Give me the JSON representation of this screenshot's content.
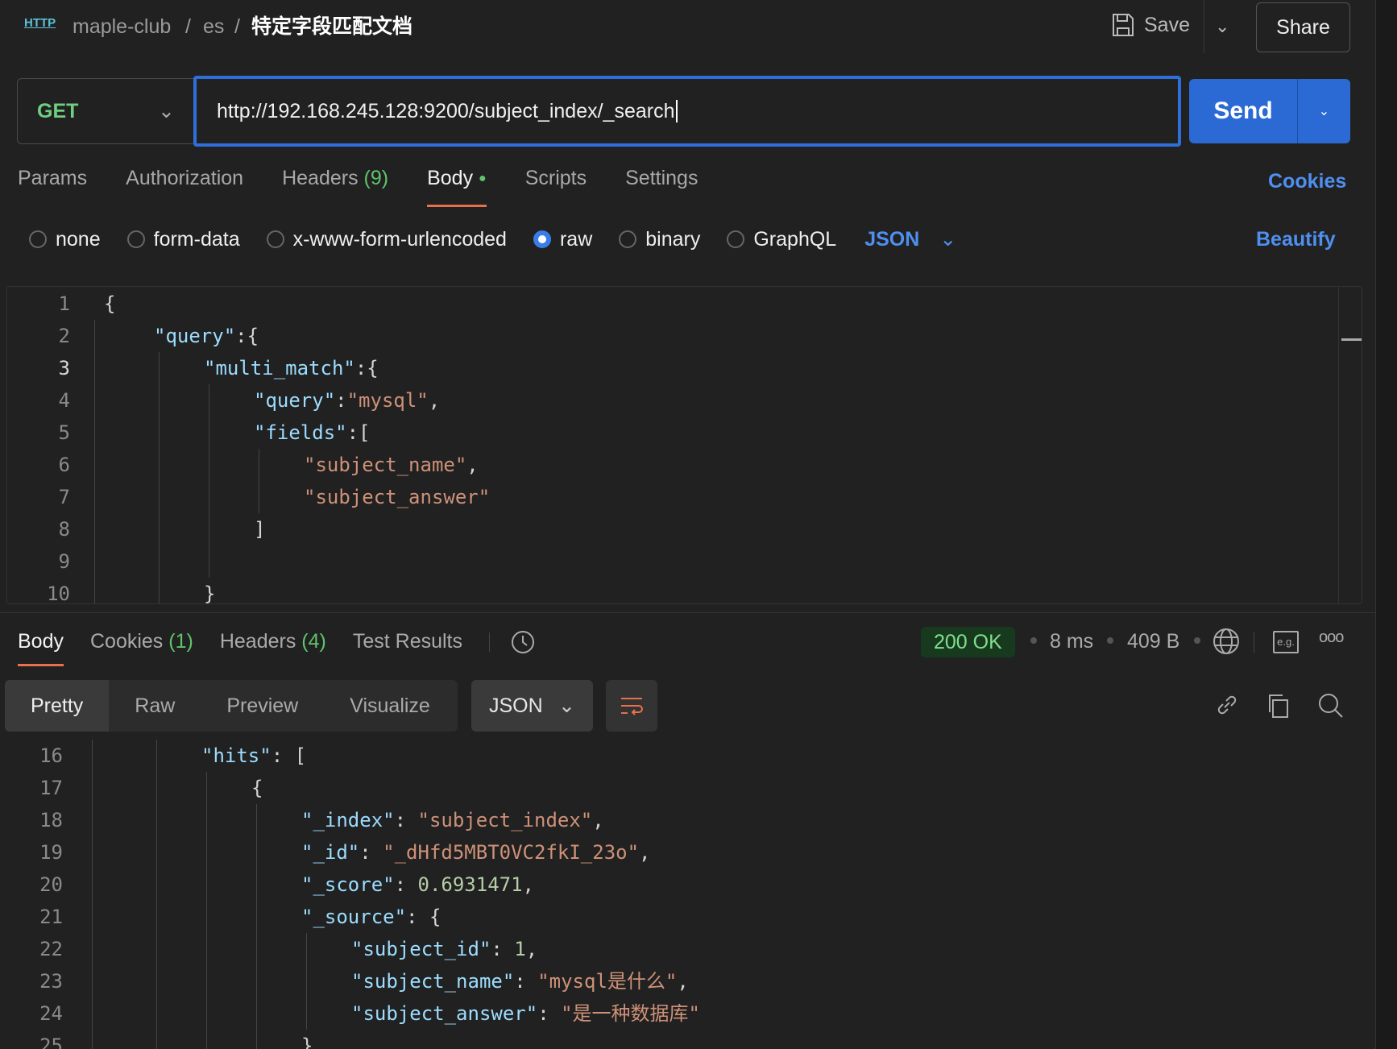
{
  "header": {
    "breadcrumb": [
      "maple-club",
      "es",
      "特定字段匹配文档"
    ],
    "save_label": "Save",
    "share_label": "Share"
  },
  "request": {
    "method": "GET",
    "url": "http://192.168.245.128:9200/subject_index/_search",
    "send_label": "Send"
  },
  "request_tabs": [
    {
      "label": "Params"
    },
    {
      "label": "Authorization"
    },
    {
      "label": "Headers",
      "count": "(9)"
    },
    {
      "label": "Body",
      "active": true,
      "dot": true
    },
    {
      "label": "Scripts"
    },
    {
      "label": "Settings"
    }
  ],
  "cookies_label": "Cookies",
  "body_types": [
    {
      "label": "none"
    },
    {
      "label": "form-data"
    },
    {
      "label": "x-www-form-urlencoded"
    },
    {
      "label": "raw",
      "selected": true
    },
    {
      "label": "binary"
    },
    {
      "label": "GraphQL"
    }
  ],
  "body_format": "JSON",
  "beautify_label": "Beautify",
  "request_body": [
    {
      "n": 1,
      "i": 0,
      "t": [
        [
          "p",
          "{"
        ]
      ]
    },
    {
      "n": 2,
      "i": 1,
      "t": [
        [
          "k",
          "\"query\""
        ],
        [
          "p",
          ":{"
        ]
      ]
    },
    {
      "n": 3,
      "i": 2,
      "t": [
        [
          "k",
          "\"multi_match\""
        ],
        [
          "p",
          ":{"
        ]
      ],
      "cur": true
    },
    {
      "n": 4,
      "i": 3,
      "t": [
        [
          "k",
          "\"query\""
        ],
        [
          "p",
          ":"
        ],
        [
          "s",
          "\"mysql\""
        ],
        [
          "p",
          ","
        ]
      ]
    },
    {
      "n": 5,
      "i": 3,
      "t": [
        [
          "k",
          "\"fields\""
        ],
        [
          "p",
          ":["
        ]
      ]
    },
    {
      "n": 6,
      "i": 4,
      "t": [
        [
          "s",
          "\"subject_name\""
        ],
        [
          "p",
          ","
        ]
      ]
    },
    {
      "n": 7,
      "i": 4,
      "t": [
        [
          "s",
          "\"subject_answer\""
        ]
      ]
    },
    {
      "n": 8,
      "i": 3,
      "t": [
        [
          "p",
          "]"
        ]
      ]
    },
    {
      "n": 9,
      "i": 3,
      "t": []
    },
    {
      "n": 10,
      "i": 2,
      "t": [
        [
          "p",
          "}"
        ]
      ]
    }
  ],
  "response_tabs": [
    {
      "label": "Body",
      "active": true
    },
    {
      "label": "Cookies",
      "count": "(1)"
    },
    {
      "label": "Headers",
      "count": "(4)"
    },
    {
      "label": "Test Results"
    }
  ],
  "response_meta": {
    "status": "200 OK",
    "time": "8 ms",
    "size": "409 B",
    "status_color": "#7fe08d"
  },
  "view_modes": [
    {
      "label": "Pretty",
      "active": true
    },
    {
      "label": "Raw"
    },
    {
      "label": "Preview"
    },
    {
      "label": "Visualize"
    }
  ],
  "response_format": "JSON",
  "response_body": [
    {
      "n": 16,
      "i": 2,
      "t": [
        [
          "k",
          "\"hits\""
        ],
        [
          "p",
          ": ["
        ]
      ]
    },
    {
      "n": 17,
      "i": 3,
      "t": [
        [
          "p",
          "{"
        ]
      ]
    },
    {
      "n": 18,
      "i": 4,
      "t": [
        [
          "k",
          "\"_index\""
        ],
        [
          "p",
          ": "
        ],
        [
          "s",
          "\"subject_index\""
        ],
        [
          "p",
          ","
        ]
      ]
    },
    {
      "n": 19,
      "i": 4,
      "t": [
        [
          "k",
          "\"_id\""
        ],
        [
          "p",
          ": "
        ],
        [
          "s",
          "\"_dHfd5MBT0VC2fkI_23o\""
        ],
        [
          "p",
          ","
        ]
      ]
    },
    {
      "n": 20,
      "i": 4,
      "t": [
        [
          "k",
          "\"_score\""
        ],
        [
          "p",
          ": "
        ],
        [
          "n",
          "0.6931471"
        ],
        [
          "p",
          ","
        ]
      ]
    },
    {
      "n": 21,
      "i": 4,
      "t": [
        [
          "k",
          "\"_source\""
        ],
        [
          "p",
          ": {"
        ]
      ]
    },
    {
      "n": 22,
      "i": 5,
      "t": [
        [
          "k",
          "\"subject_id\""
        ],
        [
          "p",
          ": "
        ],
        [
          "n",
          "1"
        ],
        [
          "p",
          ","
        ]
      ]
    },
    {
      "n": 23,
      "i": 5,
      "t": [
        [
          "k",
          "\"subject_name\""
        ],
        [
          "p",
          ": "
        ],
        [
          "s",
          "\"mysql是什么\""
        ],
        [
          "p",
          ","
        ]
      ]
    },
    {
      "n": 24,
      "i": 5,
      "t": [
        [
          "k",
          "\"subject_answer\""
        ],
        [
          "p",
          ": "
        ],
        [
          "s",
          "\"是一种数据库\""
        ]
      ]
    },
    {
      "n": 25,
      "i": 4,
      "t": [
        [
          "p",
          "}"
        ]
      ]
    }
  ]
}
